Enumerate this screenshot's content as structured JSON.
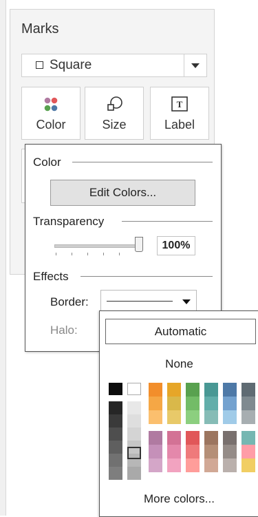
{
  "marks_card": {
    "title": "Marks",
    "mark_type": {
      "label": "Square",
      "icon": "square-icon"
    },
    "shelves": [
      {
        "label": "Color",
        "icon": "color-dots-icon"
      },
      {
        "label": "Size",
        "icon": "size-shape-icon"
      },
      {
        "label": "Label",
        "icon": "text-label-icon"
      }
    ]
  },
  "color_popup": {
    "color_section": "Color",
    "edit_colors_button": "Edit Colors...",
    "transparency_section": "Transparency",
    "opacity_value": "100%",
    "slider_level": 1.0,
    "effects_section": "Effects",
    "border_label": "Border:",
    "halo_label": "Halo:"
  },
  "palette_popup": {
    "automatic_button": "Automatic",
    "none_option": "None",
    "more_colors_link": "More colors...",
    "colors": {
      "black": "#0d0d0d",
      "white": "#ffffff",
      "gray_column": [
        "#262626",
        "#3a3a3a",
        "#4e4e4e",
        "#5f5f5f",
        "#717171",
        "#7e7e7e"
      ],
      "light_gray_column": [
        "#e8e8e8",
        "#dedede",
        "#d4d4d4",
        "#c6c6c6",
        "#b7b7b7",
        "#a9a9a9"
      ],
      "top_block": [
        [
          "#f28e2b",
          "#e6a628",
          "#59a14f",
          "#499894",
          "#4e79a7",
          "#5f6b73"
        ],
        [
          "#f5a745",
          "#d9b84a",
          "#73bc67",
          "#62aeaa",
          "#74a2cf",
          "#7f8a90"
        ],
        [
          "#fbbf6e",
          "#e8c969",
          "#8ccf7f",
          "#86bcb6",
          "#a0cbe8",
          "#a7aeb1"
        ]
      ],
      "bottom_block": [
        [
          "#b07aa1",
          "#d37295",
          "#e15759",
          "#9c755f",
          "#79706e",
          "#76b7b2"
        ],
        [
          "#c590b9",
          "#e488ab",
          "#ef7a7b",
          "#b58f77",
          "#958c88",
          "#ff9da7"
        ],
        [
          "#d4a6c8",
          "#f2a3c0",
          "#ff9d9a",
          "#d1a895",
          "#bab0ac",
          "#f1ce63"
        ]
      ]
    }
  }
}
